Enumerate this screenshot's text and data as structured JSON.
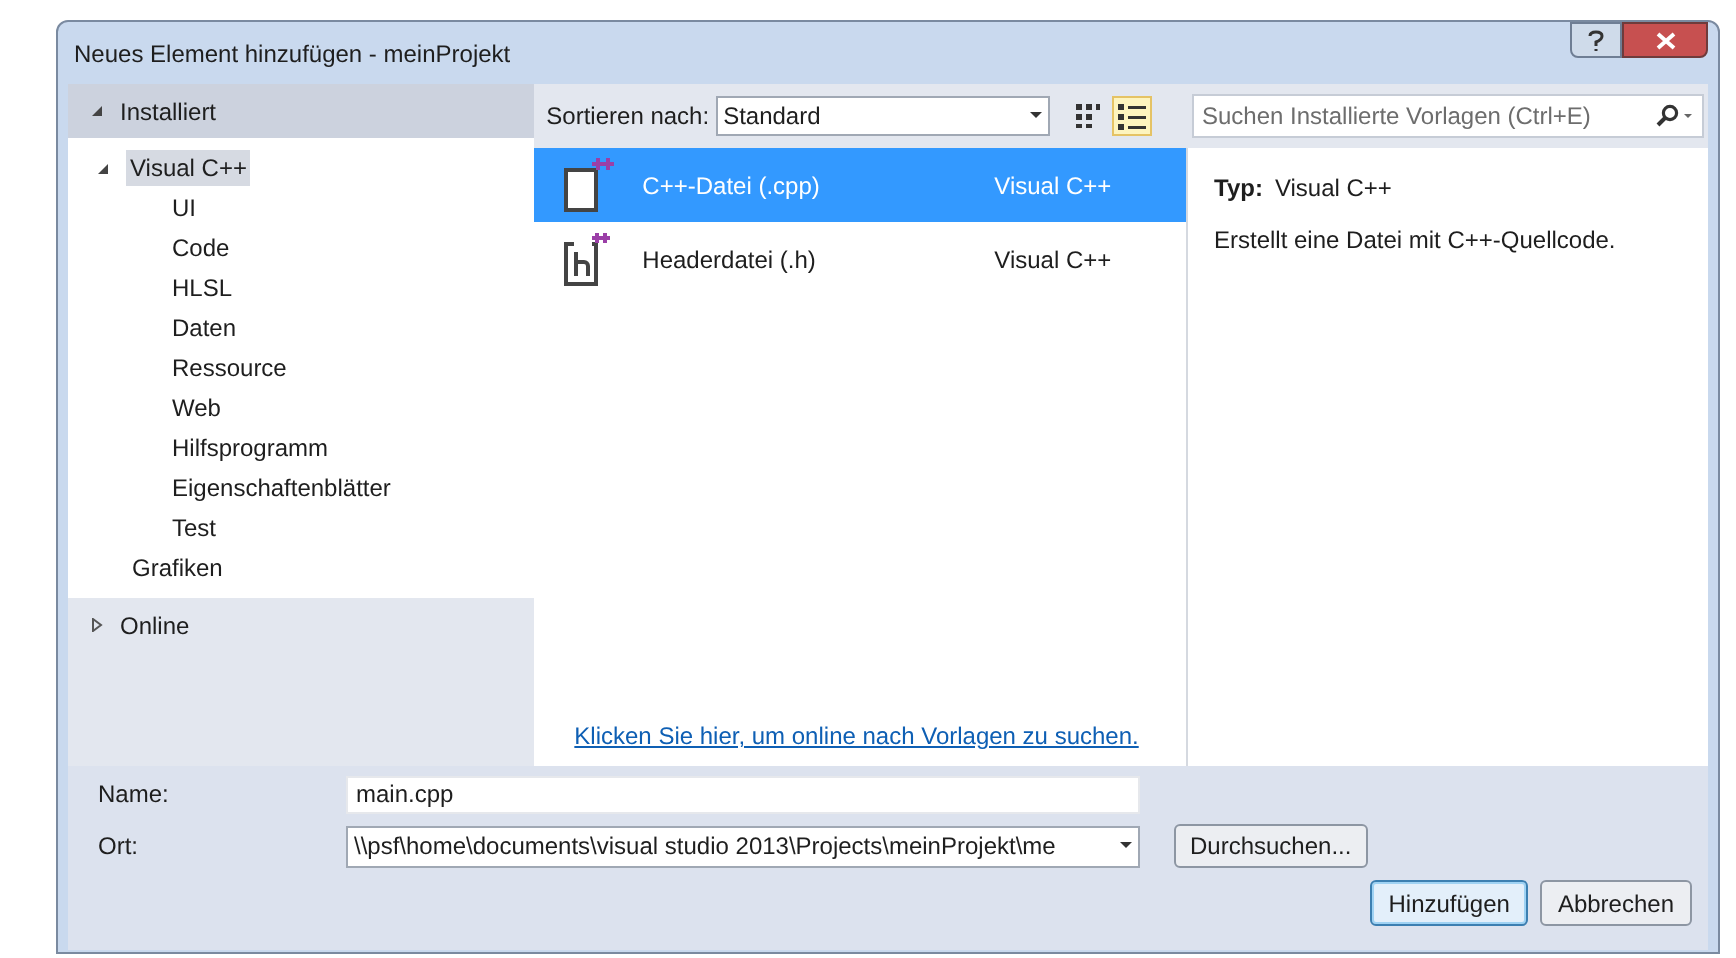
{
  "window": {
    "title": "Neues Element hinzufügen - meinProjekt"
  },
  "sections": [
    {
      "label": "Installiert",
      "expanded": true,
      "children": [
        {
          "label": "Visual C++",
          "expanded": true,
          "selected": true,
          "children": [
            {
              "label": "UI",
              "selected": false
            },
            {
              "label": "Code",
              "selected": false
            },
            {
              "label": "HLSL",
              "selected": false
            },
            {
              "label": "Daten",
              "selected": false
            },
            {
              "label": "Ressource",
              "selected": false
            },
            {
              "label": "Web",
              "selected": false
            },
            {
              "label": "Hilfsprogramm",
              "selected": false
            },
            {
              "label": "Eigenschaftenblätter",
              "selected": false
            },
            {
              "label": "Test",
              "selected": false
            }
          ]
        },
        {
          "label": "Grafiken",
          "selected": false
        }
      ]
    },
    {
      "label": "Online",
      "expanded": false
    }
  ],
  "toolbar": {
    "sort_label": "Sortieren nach:",
    "sort_value": "Standard",
    "views": [
      {
        "kind": "grid",
        "selected": false
      },
      {
        "kind": "list",
        "selected": true
      }
    ],
    "search": {
      "placeholder": "Suchen Installierte Vorlagen (Ctrl+E)"
    }
  },
  "templates": [
    {
      "kind": "cpp",
      "name": "C++-Datei (.cpp)",
      "type": "Visual C++",
      "selected": true
    },
    {
      "kind": "h",
      "name": "Headerdatei (.h)",
      "type": "Visual C++",
      "selected": false
    }
  ],
  "online_link": "Klicken Sie hier, um online nach Vorlagen zu suchen.",
  "details": {
    "type_label": "Typ:",
    "type_value": "Visual C++",
    "description": "Erstellt eine Datei mit C++-Quellcode."
  },
  "form": {
    "name_label": "Name:",
    "name_value": "main.cpp",
    "location_label": "Ort:",
    "location_value": "\\\\psf\\home\\documents\\visual studio 2013\\Projects\\meinProjekt\\me",
    "browse": "Durchsuchen..."
  },
  "buttons": [
    {
      "label": "Hinzufügen",
      "default": true
    },
    {
      "label": "Abbrechen",
      "default": false
    }
  ]
}
